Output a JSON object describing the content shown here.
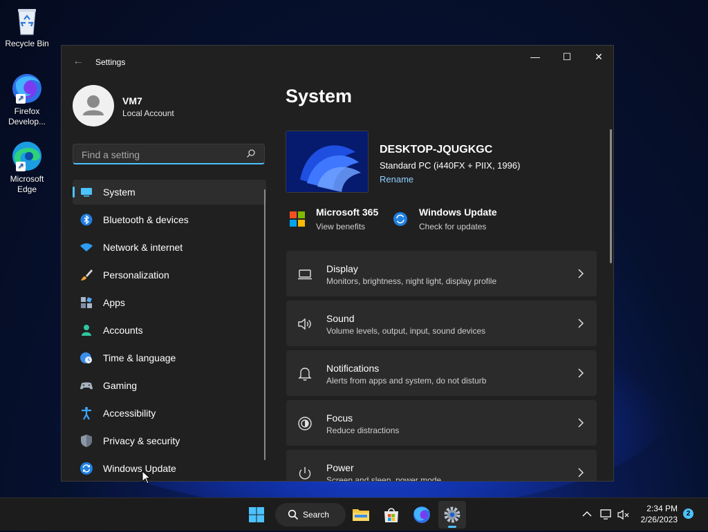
{
  "desktop": {
    "icons": [
      {
        "label": "Recycle Bin"
      },
      {
        "label": "Firefox Develop..."
      },
      {
        "label": "Microsoft Edge"
      }
    ]
  },
  "window": {
    "title": "Settings",
    "controls": {
      "minimize": "—",
      "maximize": "☐",
      "close": "✕"
    }
  },
  "account": {
    "name": "VM7",
    "type": "Local Account"
  },
  "search": {
    "placeholder": "Find a setting"
  },
  "nav": {
    "items": [
      {
        "label": "System",
        "selected": true
      },
      {
        "label": "Bluetooth & devices"
      },
      {
        "label": "Network & internet"
      },
      {
        "label": "Personalization"
      },
      {
        "label": "Apps"
      },
      {
        "label": "Accounts"
      },
      {
        "label": "Time & language"
      },
      {
        "label": "Gaming"
      },
      {
        "label": "Accessibility"
      },
      {
        "label": "Privacy & security"
      },
      {
        "label": "Windows Update"
      }
    ]
  },
  "main": {
    "title": "System",
    "pc": {
      "name": "DESKTOP-JQUGKGC",
      "model": "Standard PC (i440FX + PIIX, 1996)",
      "rename": "Rename"
    },
    "quick_links": [
      {
        "title": "Microsoft 365",
        "sub": "View benefits"
      },
      {
        "title": "Windows Update",
        "sub": "Check for updates"
      }
    ],
    "cards": [
      {
        "title": "Display",
        "sub": "Monitors, brightness, night light, display profile"
      },
      {
        "title": "Sound",
        "sub": "Volume levels, output, input, sound devices"
      },
      {
        "title": "Notifications",
        "sub": "Alerts from apps and system, do not disturb"
      },
      {
        "title": "Focus",
        "sub": "Reduce distractions"
      },
      {
        "title": "Power",
        "sub": "Screen and sleep, power mode"
      }
    ]
  },
  "taskbar": {
    "search_label": "Search",
    "time": "2:34 PM",
    "date": "2/26/2023",
    "notification_count": "2"
  },
  "colors": {
    "accent": "#4cc2ff",
    "window_bg": "#202020",
    "card_bg": "#2b2b2b"
  }
}
